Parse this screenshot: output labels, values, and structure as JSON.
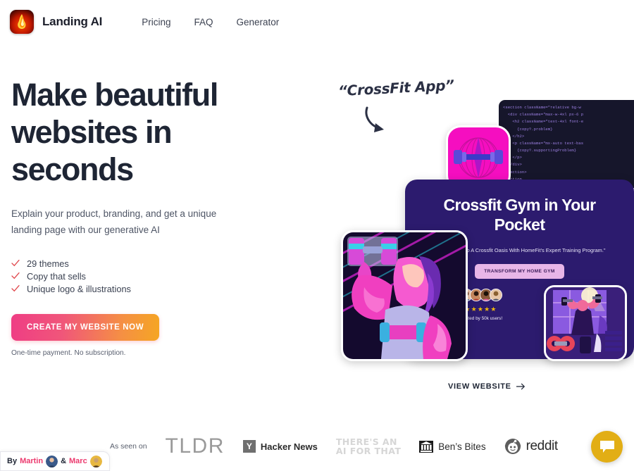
{
  "header": {
    "brand_name": "Landing AI",
    "logo_icon": "flame-icon",
    "nav": [
      {
        "label": "Pricing"
      },
      {
        "label": "FAQ"
      },
      {
        "label": "Generator"
      }
    ]
  },
  "hero": {
    "headline": "Make beautiful websites in seconds",
    "subhead": "Explain your product, branding, and get a unique landing page with our generative AI",
    "features": [
      {
        "label": "29 themes",
        "icon": "check-icon"
      },
      {
        "label": "Copy that sells",
        "icon": "check-icon"
      },
      {
        "label": "Unique logo & illustrations",
        "icon": "check-icon"
      }
    ],
    "cta_label": "CREATE MY WEBSITE NOW",
    "cta_note": "One-time payment. No subscription.",
    "accent_gradient_start": "#ef3d84",
    "accent_gradient_end": "#f5a623",
    "check_color": "#e0474c",
    "heading_color": "#1e2534"
  },
  "showcase": {
    "annotation": "“CrossFit App”",
    "annotation_arrow_icon": "curved-arrow-icon",
    "code_lines": [
      "<section className=\"relative bg-w",
      "  <div className=\"max-w-4xl px-6 p",
      "    <h2 className=\"text-4xl font-e",
      "      {copy?.problem}",
      "    </h2>",
      "    <p className=\"mx-auto text-bas",
      "      {copy?.supportingProblem}",
      "    </p>",
      "  </div>",
      "</section>",
      "",
      "<section"
    ],
    "app_icon_name": "barbell-globe-app-icon",
    "card": {
      "title": "Crossfit Gym in Your Pocket",
      "subtitle": "Your Home Into A Crossfit Oasis With HomeFit's Expert Training Program.\"",
      "button_label": "TRANSFORM MY HOME GYM",
      "stars": "★★★★★",
      "trusted_text": "Trusted by 50k users!",
      "avatar_count": 4,
      "background_color": "#2c1b6e",
      "button_color": "#e8b6e8",
      "star_color": "#f1b90b"
    },
    "illustration_left_name": "neon-bodybuilder-illustration",
    "illustration_right_name": "neon-gym-workout-illustration",
    "view_website_label": "VIEW WEBSITE",
    "view_website_arrow": "arrow-right-icon"
  },
  "press": {
    "as_seen_on": "As seen on",
    "logos": [
      {
        "name": "tldr-logo",
        "label": "TLDR"
      },
      {
        "name": "hacker-news-logo",
        "label": "Hacker News",
        "mark": "Y"
      },
      {
        "name": "theres-an-ai-for-that-logo",
        "line1": "THERE'S AN",
        "line2": "AI FOR THAT"
      },
      {
        "name": "bens-bites-logo",
        "label": "Ben’s Bites"
      },
      {
        "name": "reddit-logo",
        "label": "reddit"
      }
    ]
  },
  "footer": {
    "byline_prefix": "By",
    "author_one": "Martin",
    "byline_conjunction": "&",
    "author_two": "Marc",
    "chat_icon": "chat-bubble-icon",
    "chat_color": "#e2ae15"
  }
}
